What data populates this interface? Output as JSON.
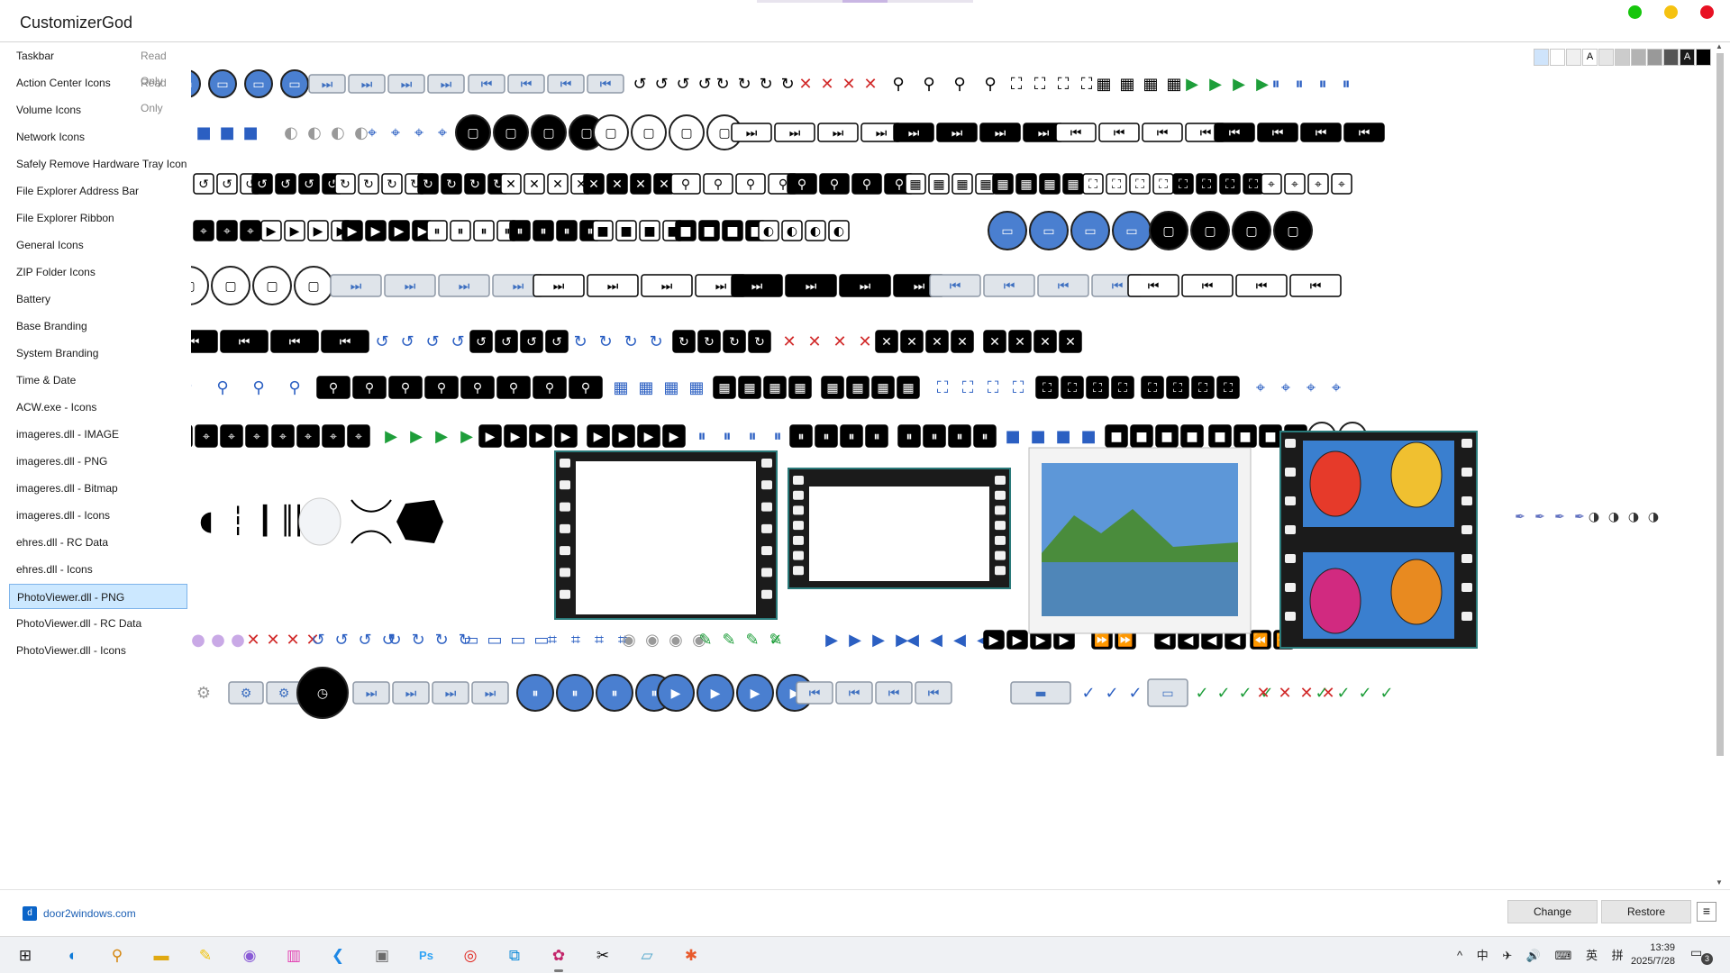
{
  "window": {
    "title": "CustomizerGod",
    "controls": {
      "green": "#16c60c",
      "yellow": "#f5c211",
      "red": "#e81123"
    }
  },
  "sidebar": {
    "items": [
      {
        "label": "Taskbar",
        "tag": "Read Only"
      },
      {
        "label": "Action Center Icons",
        "tag": "Read Only"
      },
      {
        "label": "Volume Icons",
        "tag": ""
      },
      {
        "label": "Network Icons",
        "tag": ""
      },
      {
        "label": "Safely Remove Hardware Tray Icon",
        "tag": ""
      },
      {
        "label": "File Explorer Address Bar",
        "tag": ""
      },
      {
        "label": "File Explorer Ribbon",
        "tag": ""
      },
      {
        "label": "General Icons",
        "tag": ""
      },
      {
        "label": "ZIP Folder Icons",
        "tag": ""
      },
      {
        "label": "Battery",
        "tag": ""
      },
      {
        "label": "Base Branding",
        "tag": ""
      },
      {
        "label": "System Branding",
        "tag": ""
      },
      {
        "label": "Time & Date",
        "tag": ""
      },
      {
        "label": "ACW.exe - Icons",
        "tag": ""
      },
      {
        "label": "imageres.dll - IMAGE",
        "tag": ""
      },
      {
        "label": "imageres.dll - PNG",
        "tag": ""
      },
      {
        "label": "imageres.dll - Bitmap",
        "tag": ""
      },
      {
        "label": "imageres.dll - Icons",
        "tag": ""
      },
      {
        "label": "ehres.dll - RC Data",
        "tag": ""
      },
      {
        "label": "ehres.dll - Icons",
        "tag": ""
      },
      {
        "label": "PhotoViewer.dll - PNG",
        "tag": "",
        "selected": true
      },
      {
        "label": "PhotoViewer.dll - RC Data",
        "tag": ""
      },
      {
        "label": "PhotoViewer.dll - Icons",
        "tag": ""
      }
    ]
  },
  "canvas": {
    "background_swatches": [
      "#cfe4fb",
      "#ffffff",
      "#f0f0f0",
      "#ffffff",
      "#e6e6e6",
      "#cccccc",
      "#b3b3b3",
      "#999999",
      "#555555",
      "#1a1a1a",
      "#000000"
    ],
    "swatch_letter": "A",
    "resource_icons": "player-control-glyph-grid"
  },
  "footer": {
    "link": "door2windows.com",
    "change_label": "Change",
    "restore_label": "Restore"
  },
  "taskbar": {
    "apps": [
      "start-icon",
      "edge-icon",
      "search-app-icon",
      "file-explorer-icon",
      "pen-icon",
      "disc-icon",
      "color-app-icon",
      "vscode-icon",
      "photo-app-icon",
      "photoshop-icon",
      "netease-icon",
      "snip-icon",
      "customizer-icon",
      "capcut-icon",
      "notes-icon",
      "paint-icon"
    ],
    "tray": "^ 中 ✈ 🔊 ⌨ 英 拼",
    "time": "13:39",
    "date": "2025/7/28",
    "notification_count": "3"
  }
}
